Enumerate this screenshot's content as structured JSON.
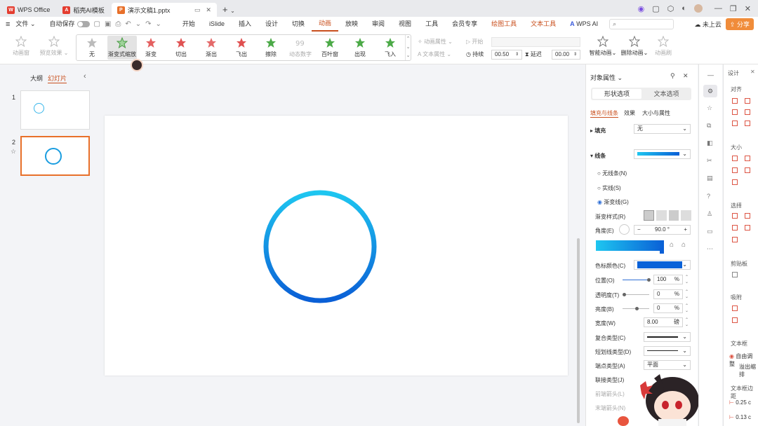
{
  "titlebar": {
    "tabs": [
      {
        "label": "WPS Office",
        "color": "#e43d30"
      },
      {
        "label": "稻壳AI模板",
        "color": "#e43d30"
      },
      {
        "label": "演示文稿1.pptx",
        "color": "#e8702a"
      }
    ],
    "new_tab": "+"
  },
  "menu": {
    "file": "文件",
    "autosave": "自动保存",
    "items": [
      "开始",
      "iSlide",
      "插入",
      "设计",
      "切换",
      "动画",
      "放映",
      "审阅",
      "视图",
      "工具",
      "会员专享",
      "绘图工具",
      "文本工具"
    ],
    "active": "动画",
    "wps_ai": "WPS AI",
    "cloud": "未上云",
    "share": "分享"
  },
  "ribbon": {
    "animation_pane": "动画窗",
    "preview": "预览效果",
    "effects": [
      "无",
      "渐变式缩放",
      "渐变",
      "切出",
      "渐出",
      "飞出",
      "擦除",
      "动态数字",
      "百叶窗",
      "出现",
      "飞入"
    ],
    "selected_effect": "渐变式缩放",
    "anim_props": "动画属性",
    "text_props": "文本属性",
    "start": "开始",
    "duration_label": "持续",
    "duration": "00.50",
    "delay_label": "延迟",
    "delay": "00.00",
    "smart": "智能动画",
    "delete": "删除动画",
    "brush": "动画刷"
  },
  "leftpane": {
    "outline": "大纲",
    "slides": "幻灯片",
    "slide_numbers": [
      "1",
      "2"
    ]
  },
  "props": {
    "title": "对象属性",
    "tabs": [
      "形状选项",
      "文本选项"
    ],
    "subtabs": [
      "填充与线条",
      "效果",
      "大小与属性"
    ],
    "fill_label": "填充",
    "fill_value": "无",
    "line_label": "线条",
    "radios": [
      "无线条(N)",
      "实线(S)",
      "渐变线(G)"
    ],
    "selected_radio": "渐变线(G)",
    "gradient_style": "渐变样式(R)",
    "angle_label": "角度(E)",
    "angle": "90.0 °",
    "stop_color": "色标颜色(C)",
    "stop_color_hex": "#0a62d8",
    "position_label": "位置(O)",
    "position": "100",
    "transparency_label": "透明度(T)",
    "transparency": "0",
    "brightness_label": "亮度(B)",
    "brightness": "0",
    "width_label": "宽度(W)",
    "width": "8.00",
    "width_unit": "磅",
    "pct": "%",
    "compound": "复合类型(C)",
    "dash": "短划线类型(D)",
    "cap": "端点类型(A)",
    "cap_value": "平面",
    "join": "联接类型(J)",
    "arrow_begin": "前端箭头(L)",
    "arrow_end": "末端箭头(N)"
  },
  "design": {
    "title": "设计",
    "align": "对齐",
    "size": "大小",
    "select": "选择",
    "clipboard": "剪贴板",
    "snap": "吸附",
    "textbox": "文本框",
    "autofit": "自由调整",
    "overflow": "溢出缩排",
    "margins": "文本框边距",
    "m1": "0.25 c",
    "m2": "0.13 c"
  },
  "colors": {
    "accent": "#c94f1d",
    "circle_top": "#1ec6f0",
    "circle_bottom": "#0a5fd6"
  }
}
